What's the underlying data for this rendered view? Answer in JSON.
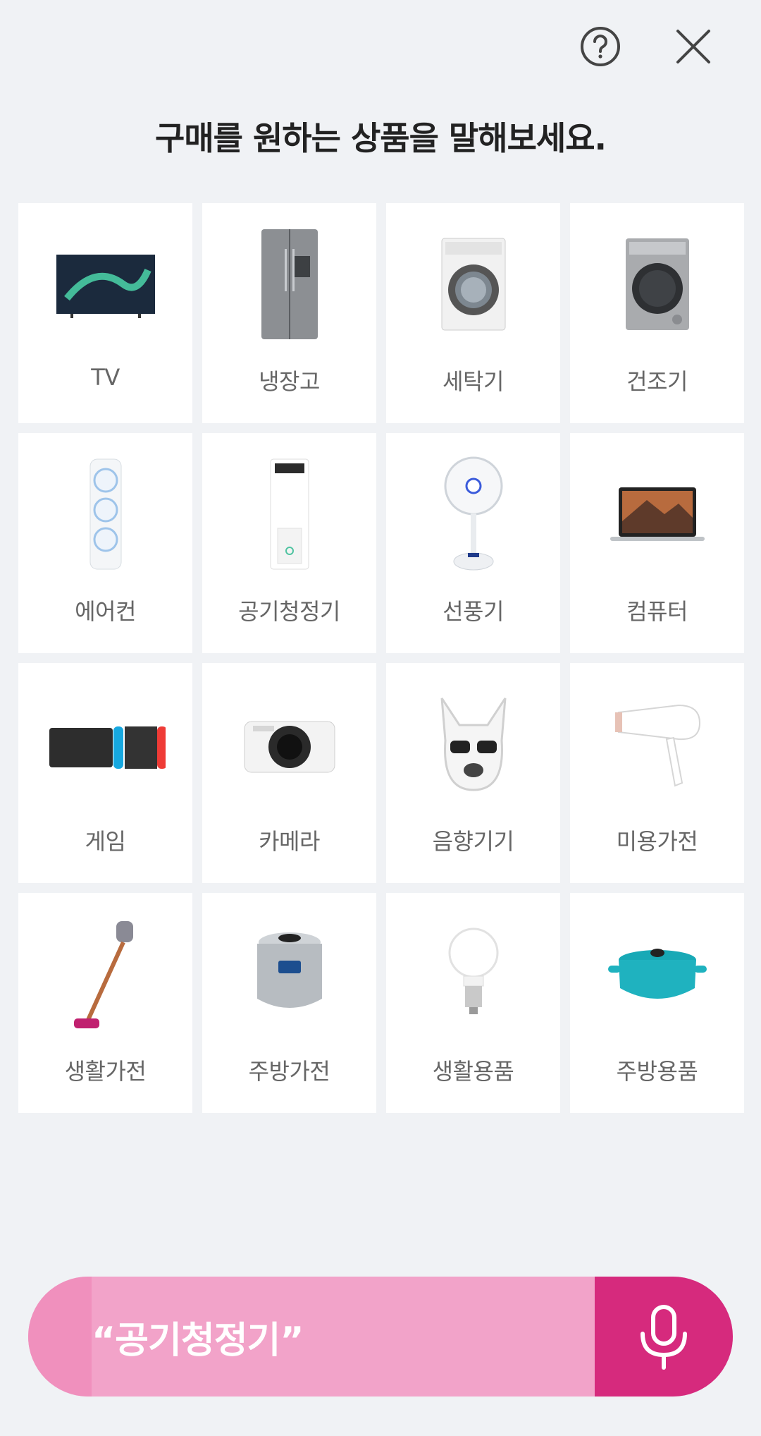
{
  "header": {
    "help_icon": "help-circle-icon",
    "close_icon": "close-icon"
  },
  "title": "구매를 원하는 상품을 말해보세요.",
  "categories": [
    {
      "label": "TV",
      "icon": "tv-image"
    },
    {
      "label": "냉장고",
      "icon": "refrigerator-image"
    },
    {
      "label": "세탁기",
      "icon": "washer-image"
    },
    {
      "label": "건조기",
      "icon": "dryer-image"
    },
    {
      "label": "에어컨",
      "icon": "air-conditioner-image"
    },
    {
      "label": "공기청정기",
      "icon": "air-purifier-image"
    },
    {
      "label": "선풍기",
      "icon": "fan-image"
    },
    {
      "label": "컴퓨터",
      "icon": "laptop-image"
    },
    {
      "label": "게임",
      "icon": "game-console-image"
    },
    {
      "label": "카메라",
      "icon": "camera-image"
    },
    {
      "label": "음향기기",
      "icon": "speaker-image"
    },
    {
      "label": "미용가전",
      "icon": "hair-dryer-image"
    },
    {
      "label": "생활가전",
      "icon": "vacuum-image"
    },
    {
      "label": "주방가전",
      "icon": "rice-cooker-image"
    },
    {
      "label": "생활용품",
      "icon": "light-bulb-image"
    },
    {
      "label": "주방용품",
      "icon": "pot-image"
    }
  ],
  "voice": {
    "query": "“공기청정기”",
    "mic_icon": "microphone-icon"
  },
  "colors": {
    "accent": "#d62a7d",
    "bar": "#f2a3c9",
    "background": "#f0f2f5"
  }
}
